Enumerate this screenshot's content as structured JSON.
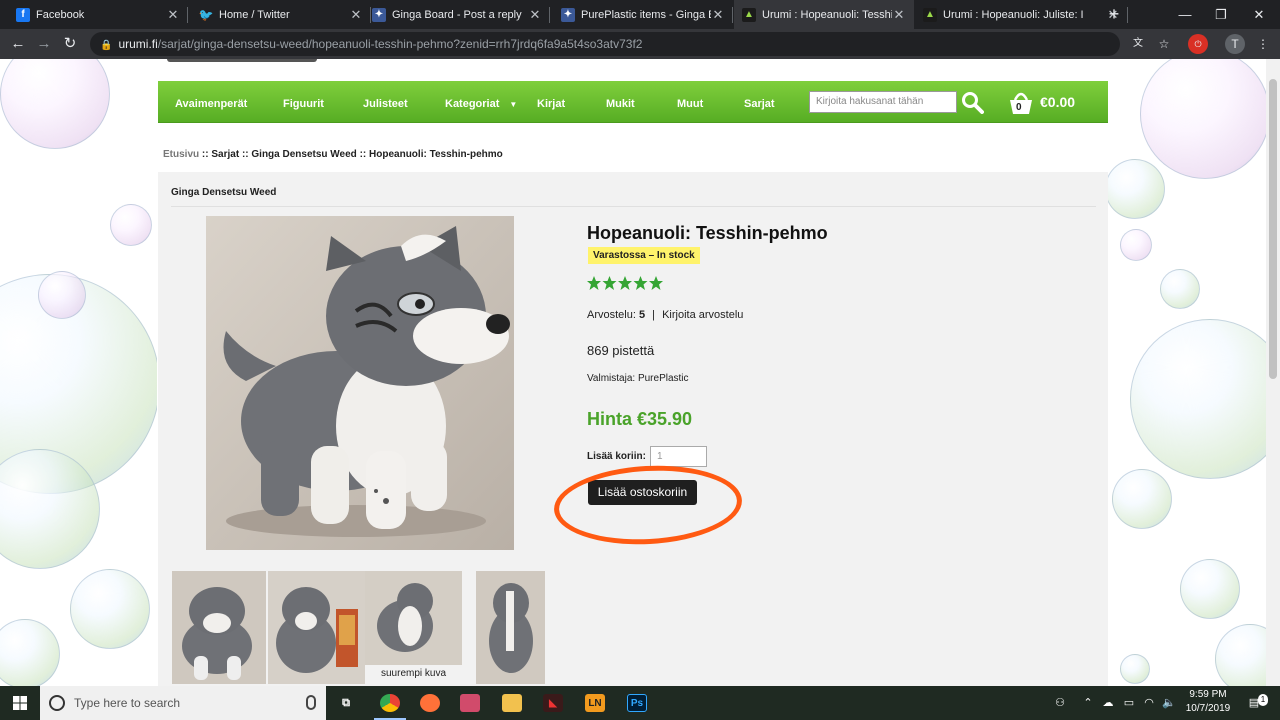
{
  "browser": {
    "tabs": [
      {
        "title": "Facebook",
        "icon": "facebook-icon",
        "color": "#1877f2",
        "glyph": "f",
        "active": false
      },
      {
        "title": "Home / Twitter",
        "icon": "twitter-icon",
        "color": "#1da1f2",
        "glyph": "t",
        "active": false
      },
      {
        "title": "Ginga Board - Post a reply",
        "icon": "forum-icon",
        "color": "#3b5998",
        "glyph": "*",
        "active": false
      },
      {
        "title": "PurePlastic items - Ginga Bo",
        "icon": "forum-icon",
        "color": "#3b5998",
        "glyph": "*",
        "active": false
      },
      {
        "title": "Urumi : Hopeanuoli: Tesshin",
        "icon": "urumi-icon",
        "color": "#6aa52c",
        "glyph": "A",
        "active": true
      },
      {
        "title": "Urumi : Hopeanuoli: Juliste: I",
        "icon": "urumi-icon",
        "color": "#6aa52c",
        "glyph": "A",
        "active": false
      }
    ],
    "url_main": "urumi.fi",
    "url_rest": "/sarjat/ginga-densetsu-weed/hopeanuoli-tesshin-pehmo?zenid=rrh7jrdq6fa9a5t4so3atv73f2",
    "profile_initial": "T"
  },
  "site": {
    "menu": [
      {
        "label": "Avaimenperät"
      },
      {
        "label": "Figuurit"
      },
      {
        "label": "Julisteet"
      },
      {
        "label": "Kategoriat"
      },
      {
        "label": "Kirjat"
      },
      {
        "label": "Mukit"
      },
      {
        "label": "Muut"
      },
      {
        "label": "Sarjat"
      }
    ],
    "search_placeholder": "Kirjoita hakusanat tähän",
    "cart_count": "0",
    "cart_total": "€0.00",
    "breadcrumb": {
      "home": "Etusivu",
      "sep": "::",
      "items": [
        "Sarjat",
        "Ginga Densetsu Weed",
        "Hopeanuoli: Tesshin-pehmo"
      ]
    },
    "category_heading": "Ginga Densetsu Weed"
  },
  "product": {
    "title": "Hopeanuoli: Tesshin-pehmo",
    "stock": "Varastossa – In stock",
    "star_rating": 5,
    "rating_label": "Arvostelu:",
    "rating_value": "5",
    "rating_sep": "|",
    "write_review": "Kirjoita arvostelu",
    "points": "869 pistettä",
    "maker": "Valmistaja: PurePlastic",
    "price": "Hinta €35.90",
    "qty_label": "Lisää koriin:",
    "qty_value": "1",
    "add_button": "Lisää ostoskoriin",
    "larger_image_link": "suurempi kuva"
  },
  "taskbar": {
    "search_placeholder": "Type here to search",
    "time": "9:59 PM",
    "date": "10/7/2019",
    "notification_count": "1"
  }
}
